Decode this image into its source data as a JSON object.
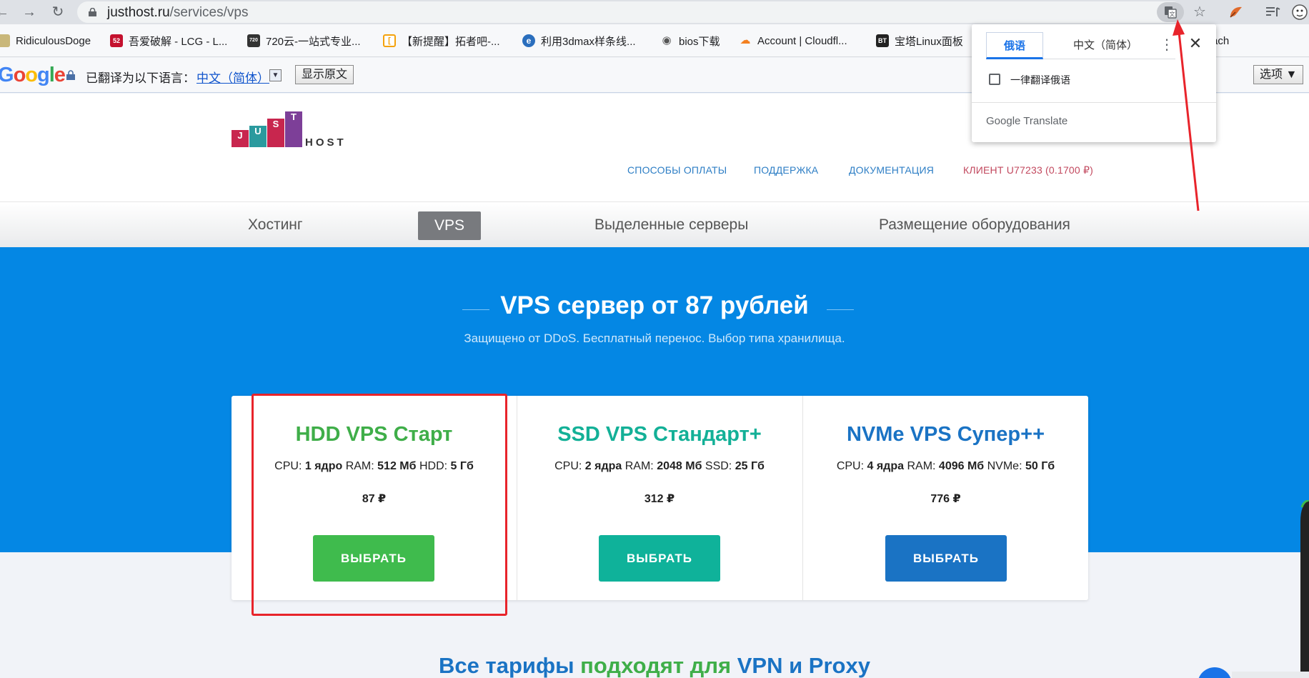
{
  "browser": {
    "url_host": "justhost.ru",
    "url_path": "/services/vps",
    "nav": {
      "back_icon": "←",
      "forward_icon": "→",
      "reload_icon": "↻"
    },
    "toolbar": {
      "star_icon": "☆",
      "menu_icon": "⁝"
    }
  },
  "bookmarks": [
    {
      "label": "RidiculousDoge",
      "color": "#7e7e7e",
      "glyph": ""
    },
    {
      "label": "吾爱破解 - LCG - L...",
      "color": "#c4112e",
      "glyph": "52"
    },
    {
      "label": "720云-一站式专业...",
      "color": "#333333",
      "glyph": "720"
    },
    {
      "label": "【新提醒】拓者吧-...",
      "color": "#f4a20c",
      "glyph": "["
    },
    {
      "label": "利用3dmax样条线...",
      "color": "#2a6ebd",
      "glyph": "e"
    },
    {
      "label": "bios下载",
      "color": "#555555",
      "glyph": "◉"
    },
    {
      "label": "Account | Cloudfl...",
      "color": "#f38020",
      "glyph": "☁"
    },
    {
      "label": "宝塔Linux面板",
      "color": "#222222",
      "glyph": "BT"
    },
    {
      "label": "ach",
      "color": "#ffffff",
      "glyph": ""
    }
  ],
  "translate_bar": {
    "label": "已翻译为以下语言：",
    "language": "中文（简体）",
    "show_original": "显示原文",
    "options": "选项 ▼"
  },
  "translate_popup": {
    "tab_source": "俄语",
    "tab_target": "中文（简体）",
    "always_translate": "一律翻译俄语",
    "brand": "Google Translate"
  },
  "site": {
    "logo_letters": [
      "J",
      "U",
      "S",
      "T"
    ],
    "logo_host": "HOST",
    "topnav": {
      "payment": "СПОСОБЫ ОПЛАТЫ",
      "support": "ПОДДЕРЖКА",
      "docs": "ДОКУМЕНТАЦИЯ",
      "client": "КЛИЕНТ U77233 (0.1700 ₽)"
    },
    "menu": {
      "hosting": "Хостинг",
      "vps": "VPS",
      "dedicated": "Выделенные серверы",
      "colocation": "Размещение оборудования"
    },
    "hero": {
      "title": "VPS сервер от 87 рублей",
      "subtitle": "Защищено от DDoS. Бесплатный перенос. Выбор типа хранилища."
    },
    "plans": [
      {
        "title": "HDD VPS Старт",
        "color": "#3fae49",
        "cpu": "1 ядро",
        "ram": "512 Мб",
        "disk_label": "HDD:",
        "disk": "5 Гб",
        "price": "87 ₽",
        "button": "ВЫБРАТЬ"
      },
      {
        "title": "SSD VPS Стандарт+",
        "color": "#13b097",
        "cpu": "2 ядра",
        "ram": "2048 Мб",
        "disk_label": "SSD:",
        "disk": "25 Гб",
        "price": "312 ₽",
        "button": "ВЫБРАТЬ"
      },
      {
        "title": "NVMe VPS Супер++",
        "color": "#1a73c4",
        "cpu": "4 ядра",
        "ram": "4096 Мб",
        "disk_label": "NVMe:",
        "disk": "50 Гб",
        "price": "776 ₽",
        "button": "ВЫБРАТЬ"
      }
    ],
    "spec_labels": {
      "cpu": "CPU:",
      "ram": "RAM:"
    },
    "bottom": {
      "part1": "Все тарифы",
      "part2": "подходят для",
      "part3": "VPN и Proxy"
    }
  }
}
